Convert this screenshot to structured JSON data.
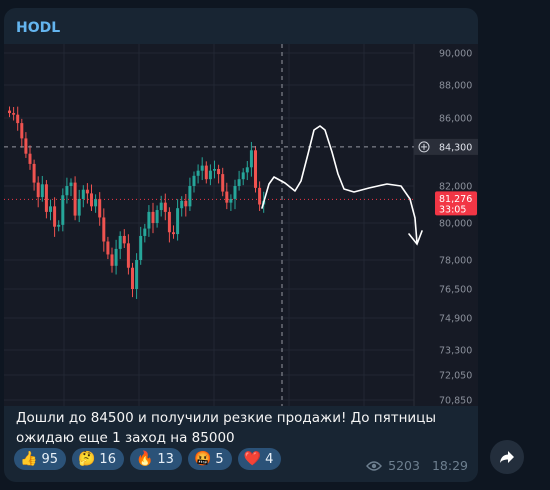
{
  "message": {
    "sender": "HODL",
    "text": "Дошли до 84500 и получили резкие продажи! До пятницы ожидаю еще 1 заход на 85000",
    "views": "5203",
    "time": "18:29"
  },
  "reactions": [
    {
      "emoji": "👍",
      "count": "95"
    },
    {
      "emoji": "🤔",
      "count": "16"
    },
    {
      "emoji": "🔥",
      "count": "13"
    },
    {
      "emoji": "🤬",
      "count": "5"
    },
    {
      "emoji": "❤️",
      "count": "4"
    }
  ],
  "chart_data": {
    "type": "candlestick",
    "y_axis_labels": [
      "90,000",
      "88,000",
      "86,000",
      "82,000",
      "80,000",
      "78,000",
      "76,500",
      "74,900",
      "73,300",
      "72,050",
      "70,850"
    ],
    "marked_level": {
      "label": "84,300",
      "style": "dashed"
    },
    "current_price": {
      "label": "81,276",
      "countdown": "33:05",
      "color": "#f23645"
    },
    "up_color": "#26a69a",
    "down_color": "#ef5350",
    "closes": [
      86300,
      86200,
      85700,
      84800,
      83900,
      83300,
      82200,
      81400,
      82100,
      80600,
      80900,
      79800,
      79900,
      81500,
      82000,
      82200,
      80400,
      81300,
      81800,
      81600,
      80900,
      81300,
      80300,
      79000,
      78300,
      77700,
      78600,
      79300,
      78900,
      77600,
      76500,
      78000,
      79300,
      79700,
      80600,
      80000,
      80700,
      81100,
      80600,
      79500,
      79400,
      80800,
      81200,
      80900,
      82000,
      82600,
      82900,
      83200,
      82400,
      82900,
      83000,
      82700,
      81700,
      81100,
      81300,
      82000,
      82400,
      82800,
      83100,
      84100,
      81900,
      81000,
      81200
    ],
    "projection": "hand-drawn arrow: rally toward ~85,800 then decline toward ~79,700"
  },
  "colors": {
    "accent": "#64b5ef",
    "bubble": "#182533",
    "reaction_bg": "#2b5278"
  },
  "icons": {
    "views": "eye-icon",
    "forward": "share-arrow-icon",
    "add_level": "plus-circle-icon"
  }
}
